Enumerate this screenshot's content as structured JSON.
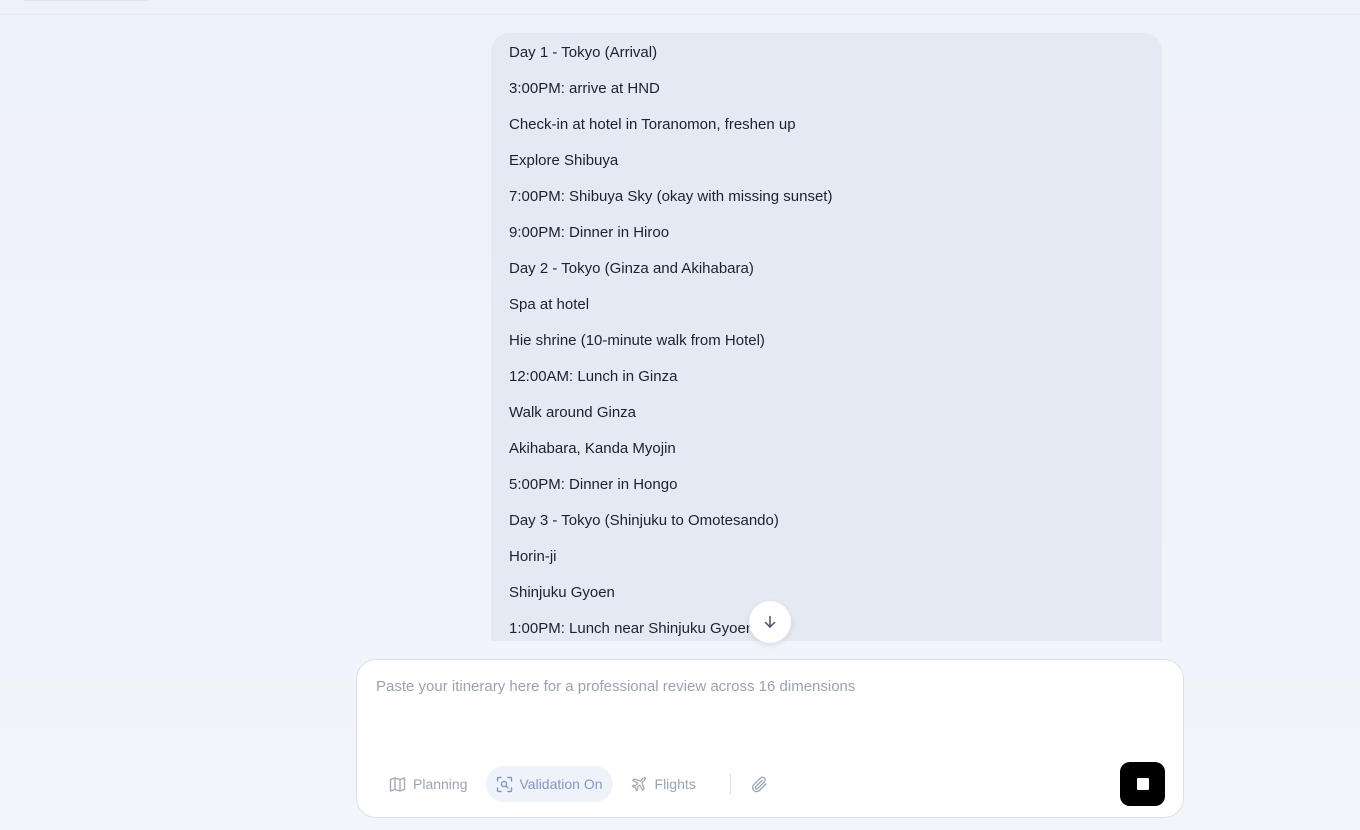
{
  "chat": {
    "user_message_lines": [
      "Day 1 - Tokyo (Arrival)",
      "3:00PM: arrive at HND",
      "Check-in at hotel in Toranomon, freshen up",
      "Explore Shibuya",
      "7:00PM: Shibuya Sky (okay with missing sunset)",
      "9:00PM: Dinner in Hiroo",
      "Day 2 - Tokyo (Ginza and Akihabara)",
      "Spa at hotel",
      "Hie shrine (10-minute walk from Hotel)",
      "12:00AM: Lunch in Ginza",
      "Walk around Ginza",
      "Akihabara, Kanda Myojin",
      "5:00PM: Dinner in Hongo",
      "Day 3 - Tokyo (Shinjuku to Omotesando)",
      "Horin-ji",
      "Shinjuku Gyoen",
      "1:00PM: Lunch near Shinjuku Gyoen"
    ]
  },
  "composer": {
    "placeholder": "Paste your itinerary here for a professional review across 16 dimensions",
    "value": ""
  },
  "toolbar": {
    "planning_label": "Planning",
    "validation_label": "Validation On",
    "validation_active": true,
    "flights_label": "Flights"
  },
  "icons": {
    "scroll": "arrow-down-icon",
    "planning": "map-icon",
    "validation": "scan-search-icon",
    "flights": "plane-icon",
    "attach": "paperclip-icon",
    "stop": "stop-icon"
  },
  "colors": {
    "bubble": "#e4e9f3",
    "active_tool": "#8597c4",
    "stop_button": "#000000"
  }
}
